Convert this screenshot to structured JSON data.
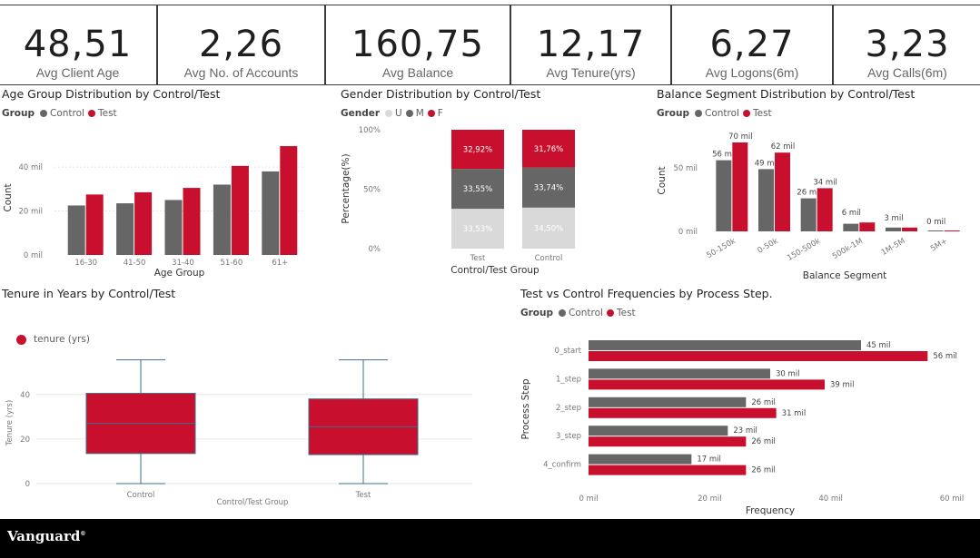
{
  "kpis": [
    {
      "value": "48,51",
      "label": "Avg Client Age"
    },
    {
      "value": "2,26",
      "label": "Avg No. of Accounts"
    },
    {
      "value": "160,75",
      "label": "Avg Balance"
    },
    {
      "value": "12,17",
      "label": "Avg Tenure(yrs)"
    },
    {
      "value": "6,27",
      "label": "Avg Logons(6m)"
    },
    {
      "value": "3,23",
      "label": "Avg Calls(6m)"
    }
  ],
  "colors": {
    "control": "#666666",
    "test": "#c8102e",
    "unknown": "#d9d9d9",
    "male": "#666666",
    "female": "#c8102e"
  },
  "age_panel": {
    "title": "Age Group Distribution by Control/Test",
    "legend_title": "Group",
    "legend_control": "Control",
    "legend_test": "Test"
  },
  "gender_panel": {
    "title": "Gender Distribution by Control/Test",
    "legend_title": "Gender",
    "legend_u": "U",
    "legend_m": "M",
    "legend_f": "F"
  },
  "balance_panel": {
    "title": "Balance Segment Distribution by Control/Test",
    "legend_title": "Group",
    "legend_control": "Control",
    "legend_test": "Test"
  },
  "tenure_panel": {
    "title": "Tenure in Years by Control/Test",
    "legend_label": "tenure (yrs)"
  },
  "process_panel": {
    "title": "Test vs Control Frequencies by Process Step.",
    "legend_title": "Group",
    "legend_control": "Control",
    "legend_test": "Test"
  },
  "footer": {
    "brand": "Vanguard"
  },
  "chart_data": [
    {
      "id": "age",
      "type": "bar",
      "title": "Age Group Distribution by Control/Test",
      "xlabel": "Age Group",
      "ylabel": "Count",
      "ylim": [
        0,
        52000
      ],
      "yticks": [
        {
          "v": 0,
          "label": "0 mil"
        },
        {
          "v": 20000,
          "label": "20 mil"
        },
        {
          "v": 40000,
          "label": "40 mil"
        }
      ],
      "categories": [
        "16-30",
        "41-50",
        "31-40",
        "51-60",
        "61+"
      ],
      "series": [
        {
          "name": "Control",
          "values": [
            22500,
            23500,
            25000,
            32000,
            38000
          ]
        },
        {
          "name": "Test",
          "values": [
            27500,
            28500,
            30500,
            40500,
            49500
          ]
        }
      ]
    },
    {
      "id": "gender",
      "type": "bar",
      "stacked": true,
      "title": "Gender Distribution by Control/Test",
      "xlabel": "Control/Test Group",
      "ylabel": "Percentage(%)",
      "yticks": [
        {
          "v": 0,
          "label": "0%"
        },
        {
          "v": 50,
          "label": "50%"
        },
        {
          "v": 100,
          "label": "100%"
        }
      ],
      "categories": [
        "Test",
        "Control"
      ],
      "series": [
        {
          "name": "U",
          "values": [
            33.53,
            34.5
          ],
          "labels": [
            "33,53%",
            "34,50%"
          ]
        },
        {
          "name": "M",
          "values": [
            33.55,
            33.74
          ],
          "labels": [
            "33,55%",
            "33,74%"
          ]
        },
        {
          "name": "F",
          "values": [
            32.92,
            31.76
          ],
          "labels": [
            "32,92%",
            "31,76%"
          ]
        }
      ]
    },
    {
      "id": "balance",
      "type": "bar",
      "title": "Balance Segment Distribution by Control/Test",
      "xlabel": "Balance Segment",
      "ylabel": "Count",
      "ylim": [
        0,
        80000
      ],
      "yticks": [
        {
          "v": 0,
          "label": "0 mil"
        },
        {
          "v": 50000,
          "label": "50 mil"
        }
      ],
      "categories": [
        "50-150k",
        "0-50k",
        "150-500k",
        "500k-1M",
        "1M-5M",
        "5M+"
      ],
      "series": [
        {
          "name": "Control",
          "values": [
            56000,
            49000,
            26000,
            6000,
            3000,
            0
          ],
          "labels": [
            "56 mil",
            "49 mil",
            "26 mil",
            "6 mil",
            "3 mil",
            "0 mil"
          ]
        },
        {
          "name": "Test",
          "values": [
            70000,
            62000,
            34000,
            7000,
            3000,
            0
          ],
          "labels": [
            "70 mil",
            "62 mil",
            "34 mil",
            "",
            "",
            ""
          ]
        }
      ]
    },
    {
      "id": "tenure",
      "type": "box",
      "title": "Tenure in Years by Control/Test",
      "xlabel": "Control/Test Group",
      "ylabel": "Tenure (yrs)",
      "ylim": [
        0,
        57
      ],
      "yticks": [
        {
          "v": 0,
          "label": "0"
        },
        {
          "v": 20,
          "label": "20"
        },
        {
          "v": 40,
          "label": "40"
        }
      ],
      "categories": [
        "Control",
        "Test"
      ],
      "boxes": [
        {
          "min": 0,
          "q1": 13.5,
          "median": 27,
          "q3": 40.5,
          "max": 55.5
        },
        {
          "min": 0,
          "q1": 13,
          "median": 25.5,
          "q3": 38,
          "max": 55.5
        }
      ]
    },
    {
      "id": "process",
      "type": "bar",
      "orientation": "horizontal",
      "title": "Test vs Control Frequencies by Process Step.",
      "xlabel": "Frequency",
      "ylabel": "Process Step",
      "xlim": [
        0,
        60000
      ],
      "xticks": [
        {
          "v": 0,
          "label": "0 mil"
        },
        {
          "v": 20000,
          "label": "20 mil"
        },
        {
          "v": 40000,
          "label": "40 mil"
        },
        {
          "v": 60000,
          "label": "60 mil"
        }
      ],
      "categories": [
        "0_start",
        "1_step",
        "2_step",
        "3_step",
        "4_confirm"
      ],
      "series": [
        {
          "name": "Control",
          "values": [
            45000,
            30000,
            26000,
            23000,
            17000
          ],
          "labels": [
            "45 mil",
            "30 mil",
            "26 mil",
            "23 mil",
            "17 mil"
          ]
        },
        {
          "name": "Test",
          "values": [
            56000,
            39000,
            31000,
            26000,
            26000
          ],
          "labels": [
            "56 mil",
            "39 mil",
            "31 mil",
            "26 mil",
            "26 mil"
          ]
        }
      ]
    }
  ]
}
